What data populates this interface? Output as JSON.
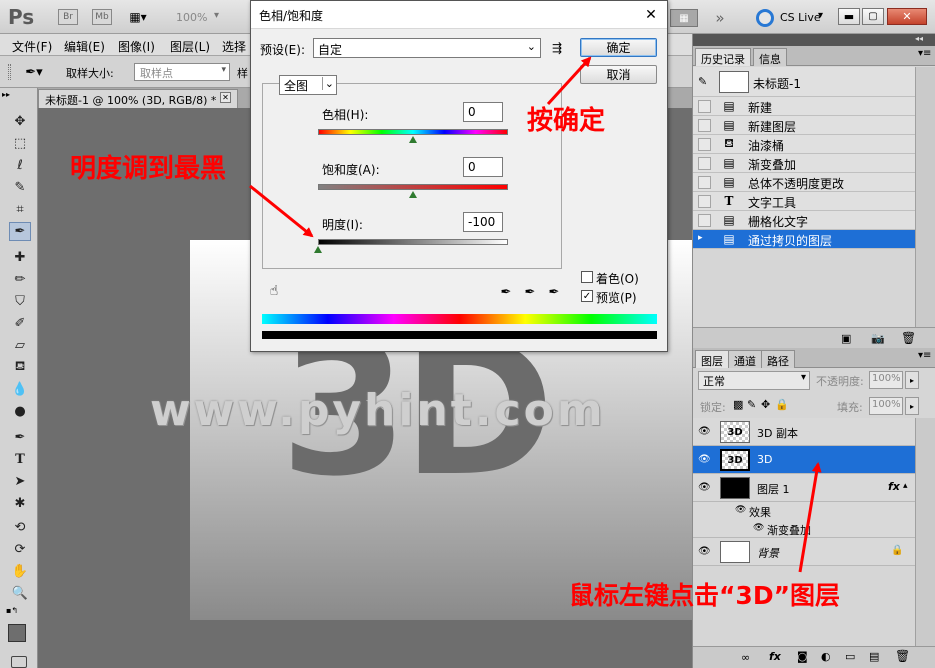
{
  "app": {
    "logo": "Ps",
    "br_badge": "Br",
    "mb_badge": "Mb",
    "zoom": "100%",
    "cs_live": "CS Live"
  },
  "menu": {
    "items": [
      "文件(F)",
      "编辑(E)",
      "图像(I)",
      "图层(L)",
      "选择"
    ]
  },
  "options": {
    "sample_size_label": "取样大小:",
    "sample_size_value": "取样点",
    "sample_tail": "样"
  },
  "document": {
    "tab_label": "未标题-1 @ 100% (3D, RGB/8) *",
    "canvas_text": "3D"
  },
  "watermark": "www.pyhint.com",
  "dialog": {
    "title": "色相/饱和度",
    "preset_label": "预设(E):",
    "preset_value": "自定",
    "ok_label": "确定",
    "cancel_label": "取消",
    "channel_value": "全图",
    "hue_label": "色相(H):",
    "hue_value": "0",
    "saturation_label": "饱和度(A):",
    "saturation_value": "0",
    "lightness_label": "明度(I):",
    "lightness_value": "-100",
    "colorize_label": "着色(O)",
    "preview_label": "预览(P)",
    "colorize_checked": false,
    "preview_checked": true
  },
  "history": {
    "tabs": [
      "历史记录",
      "信息"
    ],
    "snapshot": "未标题-1",
    "items": [
      {
        "label": "新建",
        "icon": "document-icon"
      },
      {
        "label": "新建图层",
        "icon": "document-icon"
      },
      {
        "label": "油漆桶",
        "icon": "paint-bucket-icon"
      },
      {
        "label": "渐变叠加",
        "icon": "document-icon"
      },
      {
        "label": "总体不透明度更改",
        "icon": "document-icon"
      },
      {
        "label": "文字工具",
        "icon": "text-tool-icon"
      },
      {
        "label": "栅格化文字",
        "icon": "document-icon"
      },
      {
        "label": "通过拷贝的图层",
        "icon": "document-icon"
      }
    ],
    "selected_index": 7
  },
  "layers": {
    "tabs": [
      "图层",
      "通道",
      "路径"
    ],
    "blend_mode": "正常",
    "opacity_label": "不透明度:",
    "opacity_value": "100%",
    "lock_label": "锁定:",
    "fill_label": "填充:",
    "fill_value": "100%",
    "rows": [
      {
        "name": "3D 副本",
        "thumb": "3D"
      },
      {
        "name": "3D",
        "thumb": "3D"
      },
      {
        "name": "图层 1",
        "thumb": ""
      },
      {
        "name": "效果",
        "thumb": ""
      },
      {
        "name": "渐变叠加",
        "thumb": ""
      },
      {
        "name": "背景",
        "thumb": ""
      }
    ],
    "fx_label": "fx",
    "selected_name": "3D"
  },
  "annotations": {
    "ok_hint": "按确定",
    "lightness_hint": "明度调到最黑",
    "layer_hint": "鼠标左键点击“3D”图层"
  },
  "colors": {
    "annotation_red": "#ff0000",
    "selection_blue": "#1e6fd6"
  }
}
